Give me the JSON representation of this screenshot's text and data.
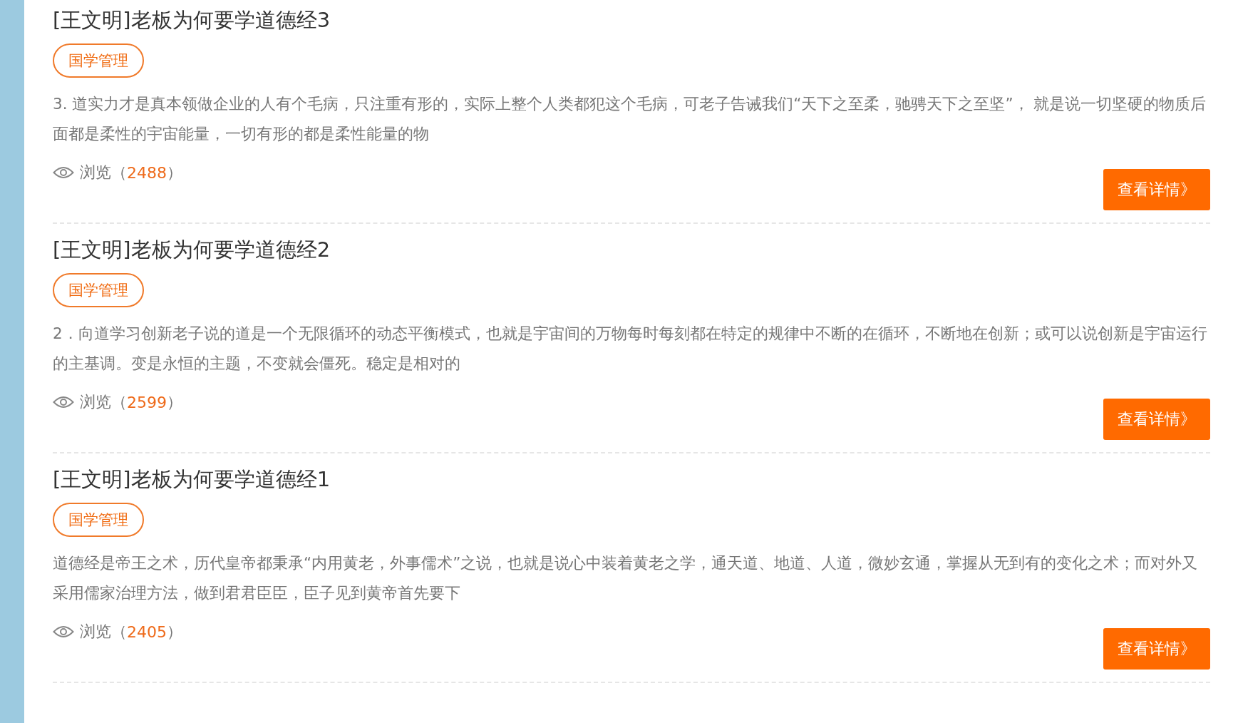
{
  "articles": [
    {
      "title": "[王文明]老板为何要学道德经3",
      "tag": "国学管理",
      "summary": "3. 道实力才是真本领做企业的人有个毛病，只注重有形的，实际上整个人类都犯这个毛病，可老子告诫我们“天下之至柔，驰骋天下之至坚”， 就是说一切坚硬的物质后面都是柔性的宇宙能量，一切有形的都是柔性能量的物",
      "views_label": "浏览（",
      "views": "2488",
      "views_close": "）",
      "button": "查看详情》"
    },
    {
      "title": "[王文明]老板为何要学道德经2",
      "tag": "国学管理",
      "summary": "2．向道学习创新老子说的道是一个无限循环的动态平衡模式，也就是宇宙间的万物每时每刻都在特定的规律中不断的在循环，不断地在创新；或可以说创新是宇宙运行的主基调。变是永恒的主题，不变就会僵死。稳定是相对的",
      "views_label": "浏览（",
      "views": "2599",
      "views_close": "）",
      "button": "查看详情》"
    },
    {
      "title": "[王文明]老板为何要学道德经1",
      "tag": "国学管理",
      "summary": "道德经是帝王之术，历代皇帝都秉承“内用黄老，外事儒术”之说，也就是说心中装着黄老之学，通天道、地道、人道，微妙玄通，掌握从无到有的变化之术；而对外又采用儒家治理方法，做到君君臣臣，臣子见到黄帝首先要下",
      "views_label": "浏览（",
      "views": "2405",
      "views_close": "）",
      "button": "查看详情》"
    }
  ]
}
